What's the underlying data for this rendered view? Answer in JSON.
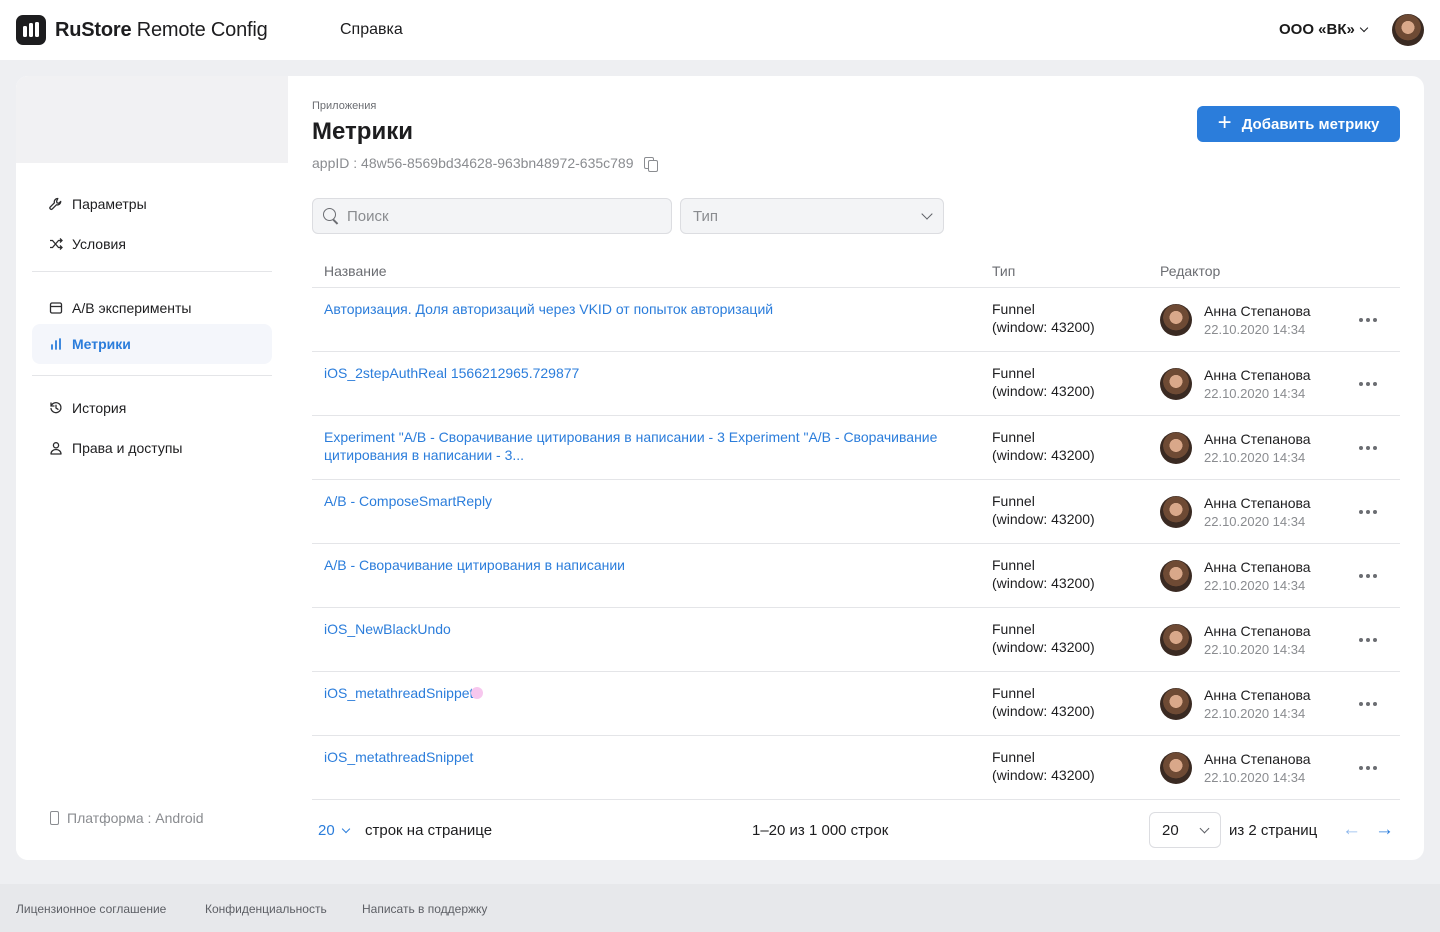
{
  "header": {
    "brand_bold": "RuStore",
    "brand_rest": "Remote Config",
    "help": "Справка",
    "org": "ООО «ВК»"
  },
  "sidebar": {
    "items": [
      {
        "label": "Параметры",
        "icon": "wrench-icon",
        "active": false
      },
      {
        "label": "Условия",
        "icon": "shuffle-icon",
        "active": false
      },
      {
        "label": "A/B эксперименты",
        "icon": "calendar-icon",
        "active": false
      },
      {
        "label": "Метрики",
        "icon": "bar-chart-icon",
        "active": true
      },
      {
        "label": "История",
        "icon": "history-icon",
        "active": false
      },
      {
        "label": "Права и доступы",
        "icon": "user-icon",
        "active": false
      }
    ],
    "platform": "Платформа : Android"
  },
  "page": {
    "breadcrumb": "Приложения",
    "title": "Метрики",
    "app_id": "appID : 48w56-8569bd34628-963bn48972-635c789",
    "add_button": "Добавить метрику"
  },
  "filters": {
    "search_placeholder": "Поиск",
    "type_placeholder": "Тип"
  },
  "table": {
    "columns": {
      "name": "Название",
      "type": "Тип",
      "editor": "Редактор"
    },
    "rows": [
      {
        "name": "Авторизация. Доля авторизаций через VKID от попыток авторизаций",
        "type1": "Funnel",
        "type2": "(window: 43200)",
        "editor": "Анна Степанова",
        "date": "22.10.2020 14:34"
      },
      {
        "name": "iOS_2stepAuthReal 1566212965.729877",
        "type1": "Funnel",
        "type2": "(window: 43200)",
        "editor": "Анна Степанова",
        "date": "22.10.2020 14:34"
      },
      {
        "name": "Experiment \"A/B - Сворачивание цитирования в написании - 3 Experiment \"A/B - Сворачивание цитирования в написании - 3...",
        "type1": "Funnel",
        "type2": "(window: 43200)",
        "editor": "Анна Степанова",
        "date": "22.10.2020 14:34"
      },
      {
        "name": "A/B - ComposeSmartReply",
        "type1": "Funnel",
        "type2": "(window: 43200)",
        "editor": "Анна Степанова",
        "date": "22.10.2020 14:34"
      },
      {
        "name": "A/B - Сворачивание цитирования в написании",
        "type1": "Funnel",
        "type2": "(window: 43200)",
        "editor": "Анна Степанова",
        "date": "22.10.2020 14:34"
      },
      {
        "name": "iOS_NewBlackUndo",
        "type1": "Funnel",
        "type2": "(window: 43200)",
        "editor": "Анна Степанова",
        "date": "22.10.2020 14:34"
      },
      {
        "name": "iOS_metathreadSnippet",
        "type1": "Funnel",
        "type2": "(window: 43200)",
        "editor": "Анна Степанова",
        "date": "22.10.2020 14:34"
      },
      {
        "name": "iOS_metathreadSnippet",
        "type1": "Funnel",
        "type2": "(window: 43200)",
        "editor": "Анна Степанова",
        "date": "22.10.2020 14:34"
      }
    ]
  },
  "pagination": {
    "page_size": "20",
    "rows_label": "строк на странице",
    "range": "1–20 из 1 000 строк",
    "current_page": "20",
    "of_pages": "из 2 страниц"
  },
  "footer": {
    "license": "Лицензионное соглашение",
    "privacy": "Конфиденциальность",
    "support": "Написать в поддержку"
  },
  "colors": {
    "accent": "#2b7ddb",
    "background": "#eeeff2"
  }
}
